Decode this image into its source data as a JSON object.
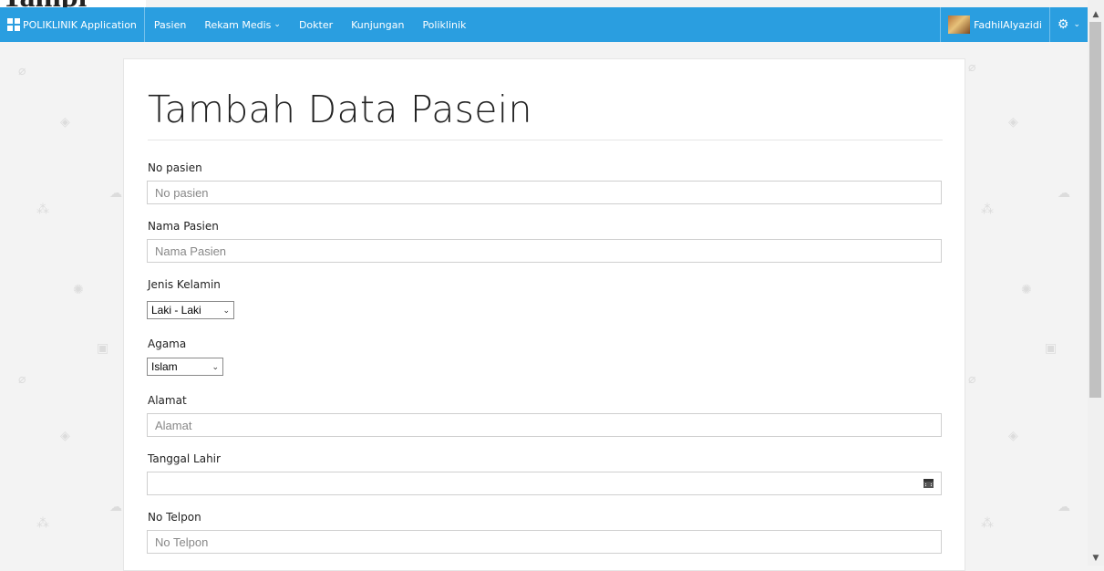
{
  "navbar": {
    "brand": "POLIKLINIK Application",
    "items": [
      {
        "label": "Pasien"
      },
      {
        "label": "Rekam Medis"
      },
      {
        "label": "Dokter"
      },
      {
        "label": "Kunjungan"
      },
      {
        "label": "Poliklinik"
      }
    ],
    "user": "FadhilAlyazidi",
    "accent": "#2a9ee0"
  },
  "page": {
    "title": "Tambah Data Pasein"
  },
  "form": {
    "no_pasien": {
      "label": "No pasien",
      "placeholder": "No pasien",
      "value": ""
    },
    "nama_pasien": {
      "label": "Nama Pasien",
      "placeholder": "Nama Pasien",
      "value": ""
    },
    "jenis_kelamin": {
      "label": "Jenis Kelamin",
      "selected": "Laki - Laki"
    },
    "agama": {
      "label": "Agama",
      "selected": "Islam"
    },
    "alamat": {
      "label": "Alamat",
      "placeholder": "Alamat",
      "value": ""
    },
    "tanggal_lahir": {
      "label": "Tanggal Lahir",
      "value": ""
    },
    "no_telpon": {
      "label": "No Telpon",
      "placeholder": "No Telpon",
      "value": ""
    }
  },
  "icons": [
    "apps-grid-icon",
    "chevron-down-icon",
    "gear-icon",
    "calendar-icon"
  ]
}
